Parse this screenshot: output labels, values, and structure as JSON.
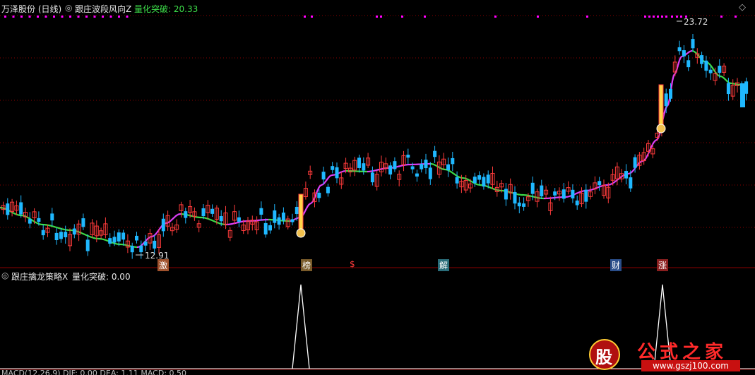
{
  "main_panel": {
    "stock_name": "万泽股份 (日线)",
    "indicator_name": "跟庄波段风向Z",
    "signal_label": "量化突破: 20.33",
    "high_label": "23.72",
    "low_label": "12.91",
    "signal_tags": [
      "激",
      "榜",
      "$",
      "解",
      "财",
      "涨"
    ]
  },
  "sub_panel": {
    "indicator_name": "跟庄擒龙策略X",
    "signal_label": "量化突破: 0.00"
  },
  "bottom_bar": {
    "label": "MACD(12,26,9) DIF: 0.00 DEA: 1.11 MACD: 0.50"
  },
  "watermark": {
    "text": "公式之家",
    "url": "www.gszj100.com",
    "badge": "股"
  },
  "colors": {
    "up": "#ff3b3b",
    "down": "#1fb8ff",
    "ma_up": "#e040fb",
    "ma_down": "#3ee04a",
    "signal": "#ffd54a",
    "accent": "#ff00ff"
  }
}
